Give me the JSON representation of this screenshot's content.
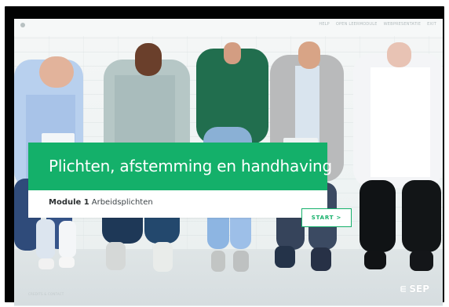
{
  "header": {
    "menu": [
      "HELP",
      "OPEN LEERMODULE",
      "WEBPRESENTATIE",
      "EXIT"
    ]
  },
  "course": {
    "title": "Plichten, afstemming en handhaving",
    "module_number": "Module 1",
    "module_subtitle": "Arbeidsplichten"
  },
  "actions": {
    "start_label": "START >"
  },
  "footer": {
    "caption": "Credits & Contact",
    "brand": "SEP"
  },
  "colors": {
    "accent_green": "#14b06a",
    "frame_black": "#020202"
  },
  "icons": {
    "brand_mark": "sep-mark-icon"
  }
}
